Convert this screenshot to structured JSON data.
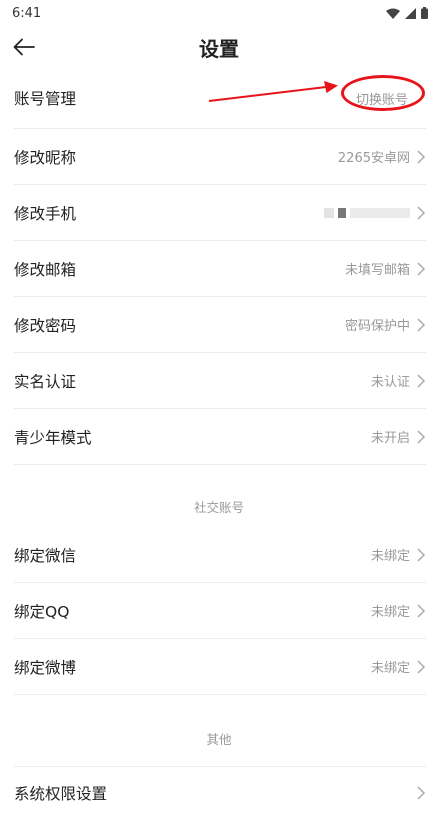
{
  "status_bar": {
    "time": "6:41"
  },
  "header": {
    "title": "设置"
  },
  "account_manage": {
    "label": "账号管理",
    "value": "切换账号"
  },
  "profile_rows": [
    {
      "label": "修改昵称",
      "value": "2265安卓网"
    },
    {
      "label": "修改手机",
      "value": ""
    },
    {
      "label": "修改邮箱",
      "value": "未填写邮箱"
    },
    {
      "label": "修改密码",
      "value": "密码保护中"
    },
    {
      "label": "实名认证",
      "value": "未认证"
    },
    {
      "label": "青少年模式",
      "value": "未开启"
    }
  ],
  "social_section": {
    "header": "社交账号",
    "rows": [
      {
        "label": "绑定微信",
        "value": "未绑定"
      },
      {
        "label": "绑定QQ",
        "value": "未绑定"
      },
      {
        "label": "绑定微博",
        "value": "未绑定"
      }
    ]
  },
  "other_section": {
    "header": "其他",
    "rows": [
      {
        "label": "系统权限设置",
        "value": ""
      }
    ]
  },
  "colors": {
    "annotation": "#e8141b",
    "muted": "#999999",
    "divider": "#ececec"
  }
}
